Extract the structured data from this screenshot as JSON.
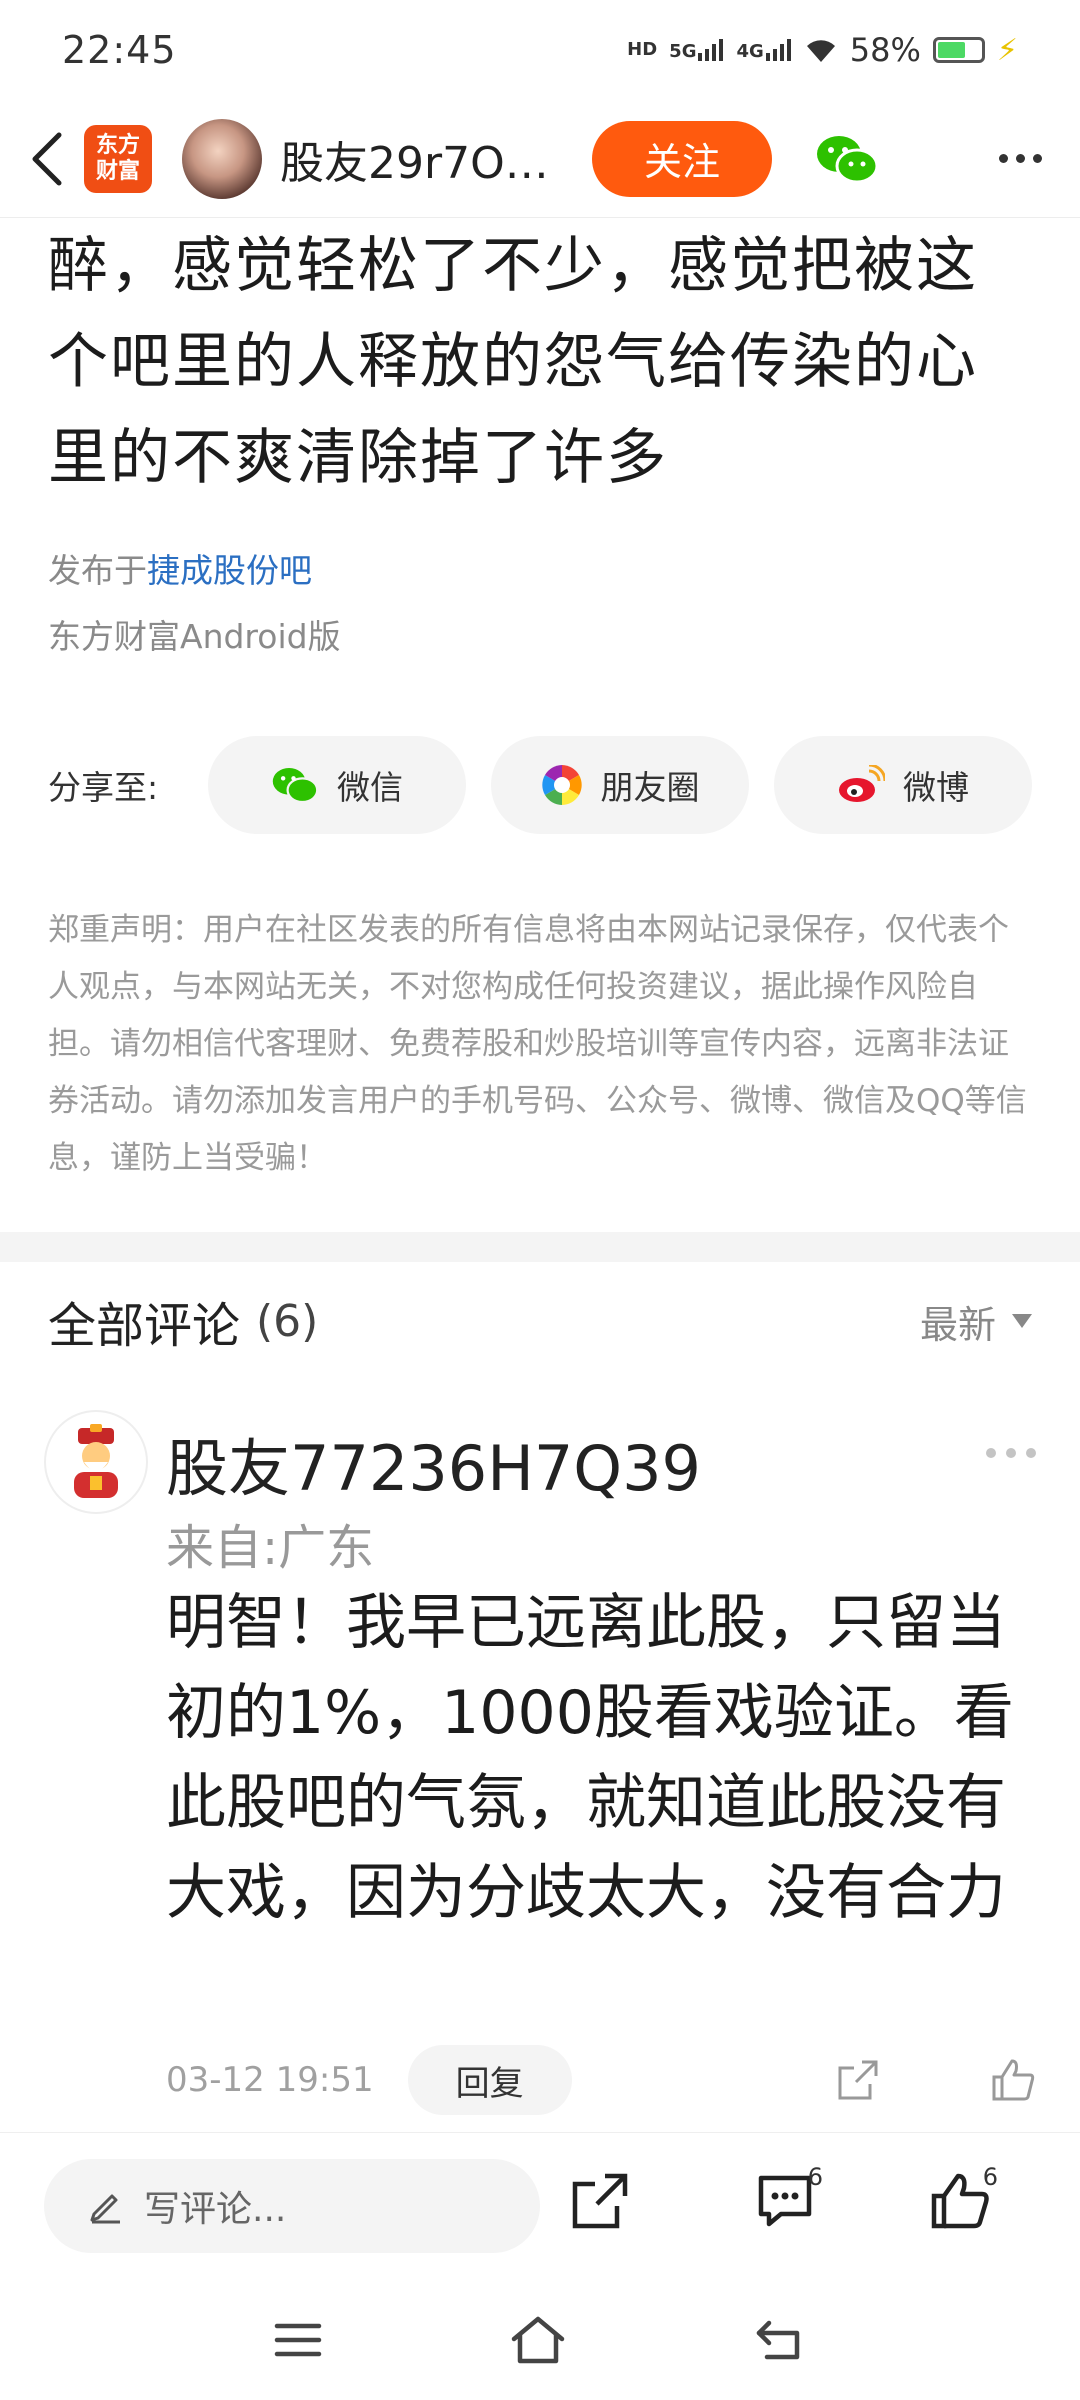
{
  "status_bar": {
    "time": "22:45",
    "hd_label": "HD",
    "net1": "5G",
    "net2": "4G",
    "battery_pct": "58%",
    "battery_level": 0.58
  },
  "nav": {
    "app_logo_line1": "东方",
    "app_logo_line2": "财富",
    "username": "股友29r7O…",
    "follow_label": "关注"
  },
  "article": {
    "text": "醉，感觉轻松了不少，感觉把被这个吧里的人释放的怨气给传染的心里的不爽清除掉了许多",
    "published_prefix": "发布于",
    "forum_name": "捷成股份吧",
    "client": "东方财富Android版"
  },
  "share": {
    "label": "分享至:",
    "wechat": "微信",
    "moments": "朋友圈",
    "weibo": "微博"
  },
  "disclaimer": "郑重声明：用户在社区发表的所有信息将由本网站记录保存，仅代表个人观点，与本网站无关，不对您构成任何投资建议，据此操作风险自担。请勿相信代客理财、免费荐股和炒股培训等宣传内容，远离非法证券活动。请勿添加发言用户的手机号码、公众号、微博、微信及QQ等信息，谨防上当受骗！",
  "comments": {
    "title": "全部评论",
    "count": "(6)",
    "sort_label": "最新",
    "items": [
      {
        "user": "股友77236H7Q39",
        "location": "来自:广东",
        "text": "明智！我早已远离此股，只留当初的1%，1000股看戏验证。看此股吧的气氛，就知道此股没有大戏，因为分歧太大，没有合力",
        "time": "03-12 19:51",
        "reply_label": "回复"
      }
    ]
  },
  "bottom_bar": {
    "write_placeholder": "写评论...",
    "comment_badge": "6",
    "like_badge": "6"
  }
}
